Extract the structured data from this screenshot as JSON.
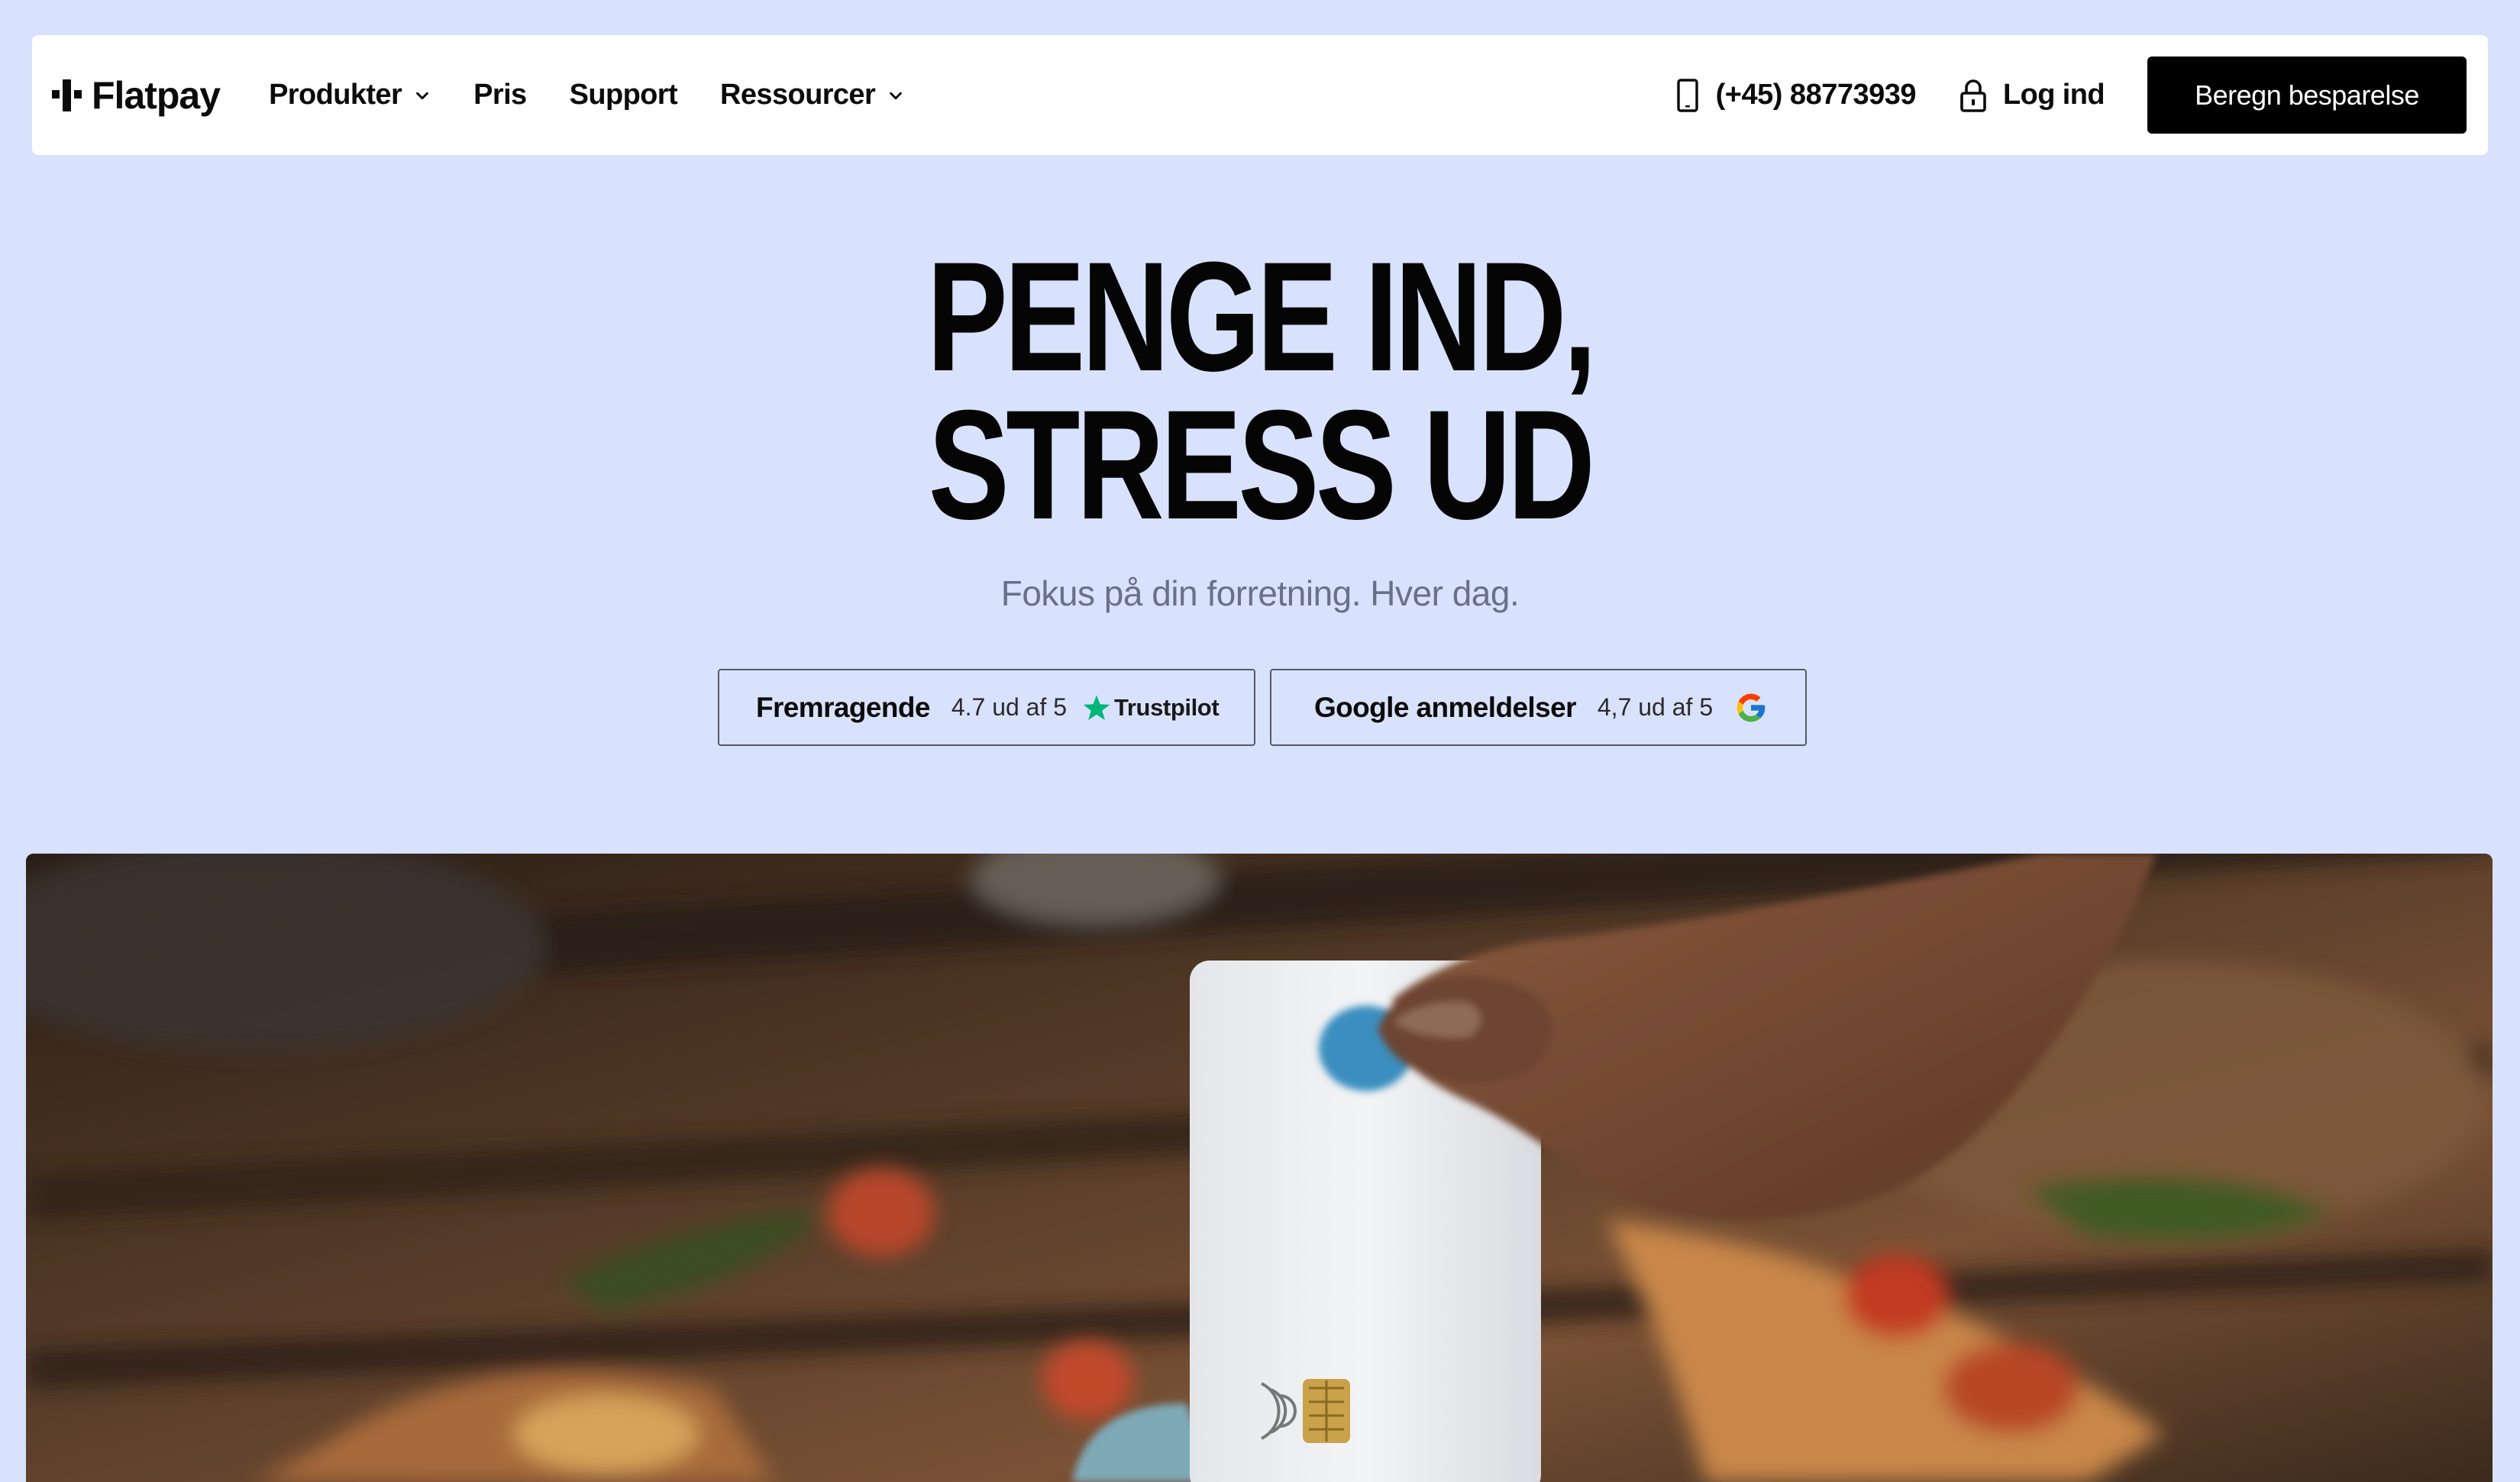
{
  "nav": {
    "logo_text": "Flatpay",
    "links": [
      {
        "label": "Produkter",
        "has_dropdown": true
      },
      {
        "label": "Pris",
        "has_dropdown": false
      },
      {
        "label": "Support",
        "has_dropdown": false
      },
      {
        "label": "Ressourcer",
        "has_dropdown": true
      }
    ],
    "phone": "(+45) 88773939",
    "login_label": "Log ind",
    "cta_label": "Beregn besparelse"
  },
  "hero": {
    "title_line1": "PENGE IND,",
    "title_line2": "STRESS UD",
    "subtitle": "Fokus på din forretning. Hver dag."
  },
  "badges": {
    "trustpilot": {
      "label": "Fremragende",
      "score": "4.7 ud af 5",
      "brand": "Trustpilot",
      "star_color": "#00b67a"
    },
    "google": {
      "label": "Google anmeldelser",
      "score": "4,7 ud af 5"
    }
  },
  "colors": {
    "page_bg": "#d9e2fc",
    "cta_bg": "#000000",
    "subtitle": "#6a7087"
  }
}
